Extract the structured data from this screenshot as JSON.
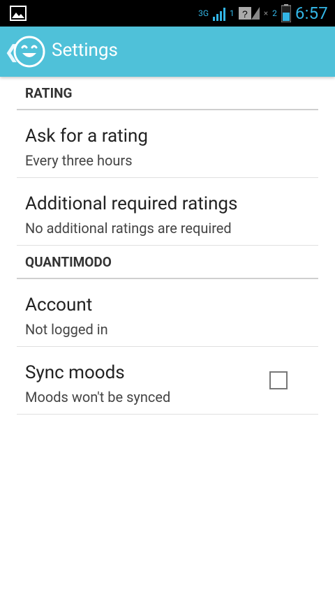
{
  "status": {
    "time": "6:57",
    "network": "3G",
    "sim1": "1",
    "sim2": "2"
  },
  "actionbar": {
    "title": "Settings"
  },
  "sections": [
    {
      "header": "RATING",
      "items": [
        {
          "title": "Ask for a rating",
          "summary": "Every three hours"
        },
        {
          "title": "Additional required ratings",
          "summary": "No additional ratings are required"
        }
      ]
    },
    {
      "header": "QUANTIMODO",
      "items": [
        {
          "title": "Account",
          "summary": "Not logged in"
        },
        {
          "title": "Sync moods",
          "summary": "Moods won't be synced",
          "checked": false
        }
      ]
    }
  ],
  "colors": {
    "accent": "#4fc1d9",
    "status_blue": "#33b5e5"
  }
}
